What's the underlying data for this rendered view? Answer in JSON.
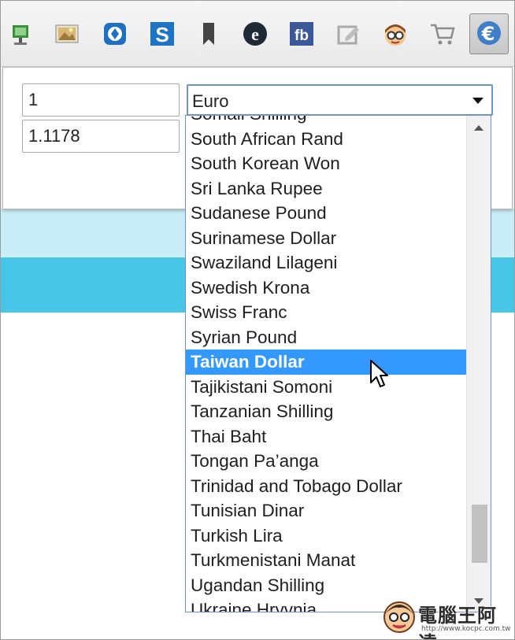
{
  "toolbar": {
    "icons": [
      "download-icon",
      "image-icon",
      "nav-icon",
      "s-app-icon",
      "bookmark-icon",
      "e-icon",
      "fb-icon",
      "edit-icon",
      "avatar-icon",
      "cart-icon",
      "euro-icon"
    ],
    "fb_label": "fb",
    "s_label": "S",
    "euro_symbol": "€"
  },
  "converter": {
    "amount_value": "1",
    "result_value": "1.1178",
    "currency_selected": "Euro"
  },
  "dropdown": {
    "options": [
      "Somali Shilling",
      "South African Rand",
      "South Korean Won",
      "Sri Lanka Rupee",
      "Sudanese Pound",
      "Surinamese Dollar",
      "Swaziland Lilageni",
      "Swedish Krona",
      "Swiss Franc",
      "Syrian Pound",
      "Taiwan Dollar",
      "Tajikistani Somoni",
      "Tanzanian Shilling",
      "Thai Baht",
      "Tongan Pa’anga",
      "Trinidad and Tobago Dollar",
      "Tunisian Dinar",
      "Turkish Lira",
      "Turkmenistani Manat",
      "Ugandan Shilling",
      "Ukraine Hryvnia"
    ],
    "highlighted": "Taiwan Dollar"
  },
  "colors": {
    "highlight": "#3399ff",
    "band_light": "#c9eef7",
    "band_dark": "#47c6e8",
    "select_border": "#6d95d4"
  },
  "watermark": {
    "title": "電腦王阿達",
    "url": "http://www.kocpc.com.tw"
  }
}
